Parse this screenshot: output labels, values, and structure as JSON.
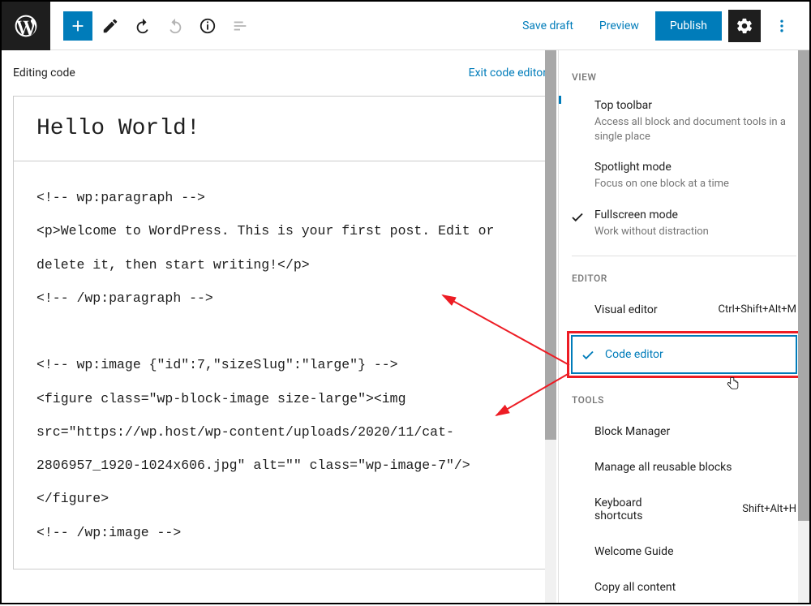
{
  "topbar": {
    "save_draft": "Save draft",
    "preview": "Preview",
    "publish": "Publish"
  },
  "editor": {
    "editing_label": "Editing code",
    "exit_label": "Exit code editor",
    "title": "Hello World!",
    "code": "<!-- wp:paragraph -->\n<p>Welcome to WordPress. This is your first post. Edit or delete it, then start writing!</p>\n<!-- /wp:paragraph -->\n\n<!-- wp:image {\"id\":7,\"sizeSlug\":\"large\"} -->\n<figure class=\"wp-block-image size-large\"><img src=\"https://wp.host/wp-content/uploads/2020/11/cat-2806957_1920-1024x606.jpg\" alt=\"\" class=\"wp-image-7\"/></figure>\n<!-- /wp:image -->"
  },
  "sidebar": {
    "view_label": "VIEW",
    "top_toolbar": {
      "title": "Top toolbar",
      "desc": "Access all block and document tools in a single place"
    },
    "spotlight": {
      "title": "Spotlight mode",
      "desc": "Focus on one block at a time"
    },
    "fullscreen": {
      "title": "Fullscreen mode",
      "desc": "Work without distraction"
    },
    "editor_label": "EDITOR",
    "visual_editor": {
      "title": "Visual editor",
      "shortcut": "Ctrl+Shift+Alt+M"
    },
    "code_editor": {
      "title": "Code editor"
    },
    "tools_label": "TOOLS",
    "block_manager": "Block Manager",
    "reusable": "Manage all reusable blocks",
    "kbd": {
      "title": "Keyboard shortcuts",
      "shortcut": "Shift+Alt+H"
    },
    "welcome": "Welcome Guide",
    "copy_all": "Copy all content"
  }
}
